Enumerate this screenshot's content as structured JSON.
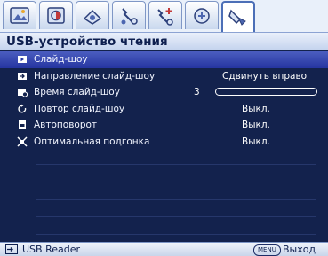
{
  "tabs": [
    {
      "icon": "picture-icon",
      "active": false
    },
    {
      "icon": "image-adjust-icon",
      "active": false
    },
    {
      "icon": "source-icon",
      "active": false
    },
    {
      "icon": "system-setup-icon",
      "active": false
    },
    {
      "icon": "advanced-setup-icon",
      "active": false
    },
    {
      "icon": "information-icon",
      "active": false
    },
    {
      "icon": "usb-reader-icon",
      "active": true
    }
  ],
  "title": "USB-устройство чтения",
  "menu": {
    "items": [
      {
        "label": "Слайд-шоу",
        "value": "",
        "icon": "play-icon",
        "selected": true
      },
      {
        "label": "Направление слайд-шоу",
        "value": "Сдвинуть вправо",
        "icon": "slide-direction-icon",
        "selected": false
      },
      {
        "label": "Время слайд-шоу",
        "value": "3",
        "icon": "timer-icon",
        "selected": false
      },
      {
        "label": "Повтор слайд-шоу",
        "value": "Выкл.",
        "icon": "repeat-icon",
        "selected": false
      },
      {
        "label": "Автоповорот",
        "value": "Выкл.",
        "icon": "auto-rotate-icon",
        "selected": false
      },
      {
        "label": "Оптимальная подгонка",
        "value": "Выкл.",
        "icon": "best-fit-icon",
        "selected": false
      }
    ]
  },
  "bottom": {
    "source_label": "USB Reader",
    "menu_key": "MENU",
    "exit_label": "Выход"
  },
  "colors": {
    "background": "#13224d",
    "selected_row": "#3344b0",
    "title_bar": "#dbe4f6",
    "text": "#f2f5ff"
  }
}
